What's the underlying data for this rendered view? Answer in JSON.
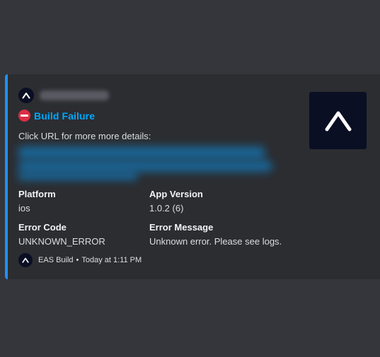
{
  "embed": {
    "accent_color": "#1e90ff",
    "author": {
      "icon": "expo-logo-icon",
      "name_redacted": true
    },
    "title": {
      "icon": "no-entry-icon",
      "text": "Build Failure",
      "color": "#00a8fc"
    },
    "description": "Click URL for more more details:",
    "url_redacted": true,
    "fields": [
      {
        "name": "Platform",
        "value": "ios"
      },
      {
        "name": "App Version",
        "value": "1.0.2 (6)"
      },
      {
        "name": "Error Code",
        "value": "UNKNOWN_ERROR"
      },
      {
        "name": "Error Message",
        "value": "Unknown error. Please see logs."
      }
    ],
    "footer": {
      "icon": "expo-logo-icon",
      "text": "EAS Build",
      "separator": "•",
      "timestamp": "Today at 1:11 PM"
    },
    "thumbnail": {
      "icon": "expo-logo-icon"
    }
  }
}
